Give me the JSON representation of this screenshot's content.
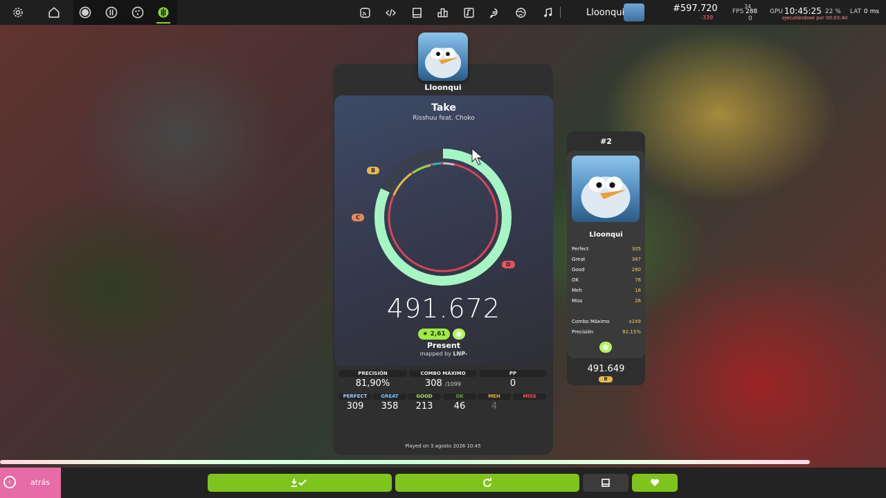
{
  "topbar": {
    "icons": [
      "gear-icon",
      "home-icon",
      "mode-standard-icon",
      "mode-taiko-icon",
      "mode-catch-icon",
      "mode-mania-icon",
      "rss-icon",
      "code-icon",
      "wiki-icon",
      "rankings-icon",
      "beatmaps-icon",
      "chat-icon",
      "web-icon",
      "music-icon"
    ],
    "username": "Lloonqui",
    "rank": "#597.720",
    "rank_delta": "-339",
    "fps_label": "FPS",
    "fps_value": "288",
    "fps_sub": "0",
    "fps_top": "34",
    "gpu_label": "GPU",
    "clock": "10:45:25",
    "cpu_value": "22 %",
    "lat_label": "LAT",
    "lat_value": "0 ms",
    "running": "ejecutándose por 00:03:40"
  },
  "panel": {
    "username": "Lloonqui",
    "title": "Take",
    "artist": "Risshuu feat. Choko",
    "grade_labels": {
      "b": "B",
      "c": "C",
      "d": "D"
    },
    "score": "491.672",
    "stars": "★ 2,61",
    "difficulty": "Present",
    "mapped_by_prefix": "mapped by ",
    "mapper": "LNP-",
    "stats": [
      {
        "label": "PRECISIÓN",
        "value": "81,90%"
      },
      {
        "label": "COMBO MÁXIMO",
        "value": "308",
        "sub": "/1099"
      },
      {
        "label": "PP",
        "value": "0"
      }
    ],
    "hits": [
      {
        "label": "PERFECT",
        "value": "309",
        "color": "#9bd0ff"
      },
      {
        "label": "GREAT",
        "value": "358",
        "color": "#67c6ff"
      },
      {
        "label": "GOOD",
        "value": "213",
        "color": "#a8e85a"
      },
      {
        "label": "OK",
        "value": "46",
        "color": "#5fa83a"
      },
      {
        "label": "MEH",
        "value": "4",
        "color": "#e0b23c"
      },
      {
        "label": "MISS",
        "value": "",
        "color": "#ff4a4a"
      }
    ],
    "played": "Played on 3 agosto 2026 10:45",
    "accuracy_fraction": 0.819
  },
  "side": {
    "rank": "#2",
    "username": "Lloonqui",
    "rows": [
      {
        "label": "Perfect",
        "value": "305"
      },
      {
        "label": "Great",
        "value": "387"
      },
      {
        "label": "Good",
        "value": "280"
      },
      {
        "label": "OK",
        "value": "76"
      },
      {
        "label": "Meh",
        "value": "18"
      },
      {
        "label": "Miss",
        "value": "26"
      }
    ],
    "combo_label": "Combo Máximo",
    "combo_value": "x249",
    "accuracy_label": "Precisión",
    "accuracy_value": "82.15%",
    "score": "491.649",
    "grade": "B"
  },
  "bottom": {
    "back_label": "atrás",
    "buttons": [
      "download-button",
      "retry-button",
      "details-button",
      "favourite-button"
    ]
  },
  "colors": {
    "accent_green": "#7fc41c",
    "back_pink": "#e66ba6",
    "grade_b": "#e7b84a",
    "grade_c": "#e8875a",
    "grade_d": "#e3545f"
  }
}
